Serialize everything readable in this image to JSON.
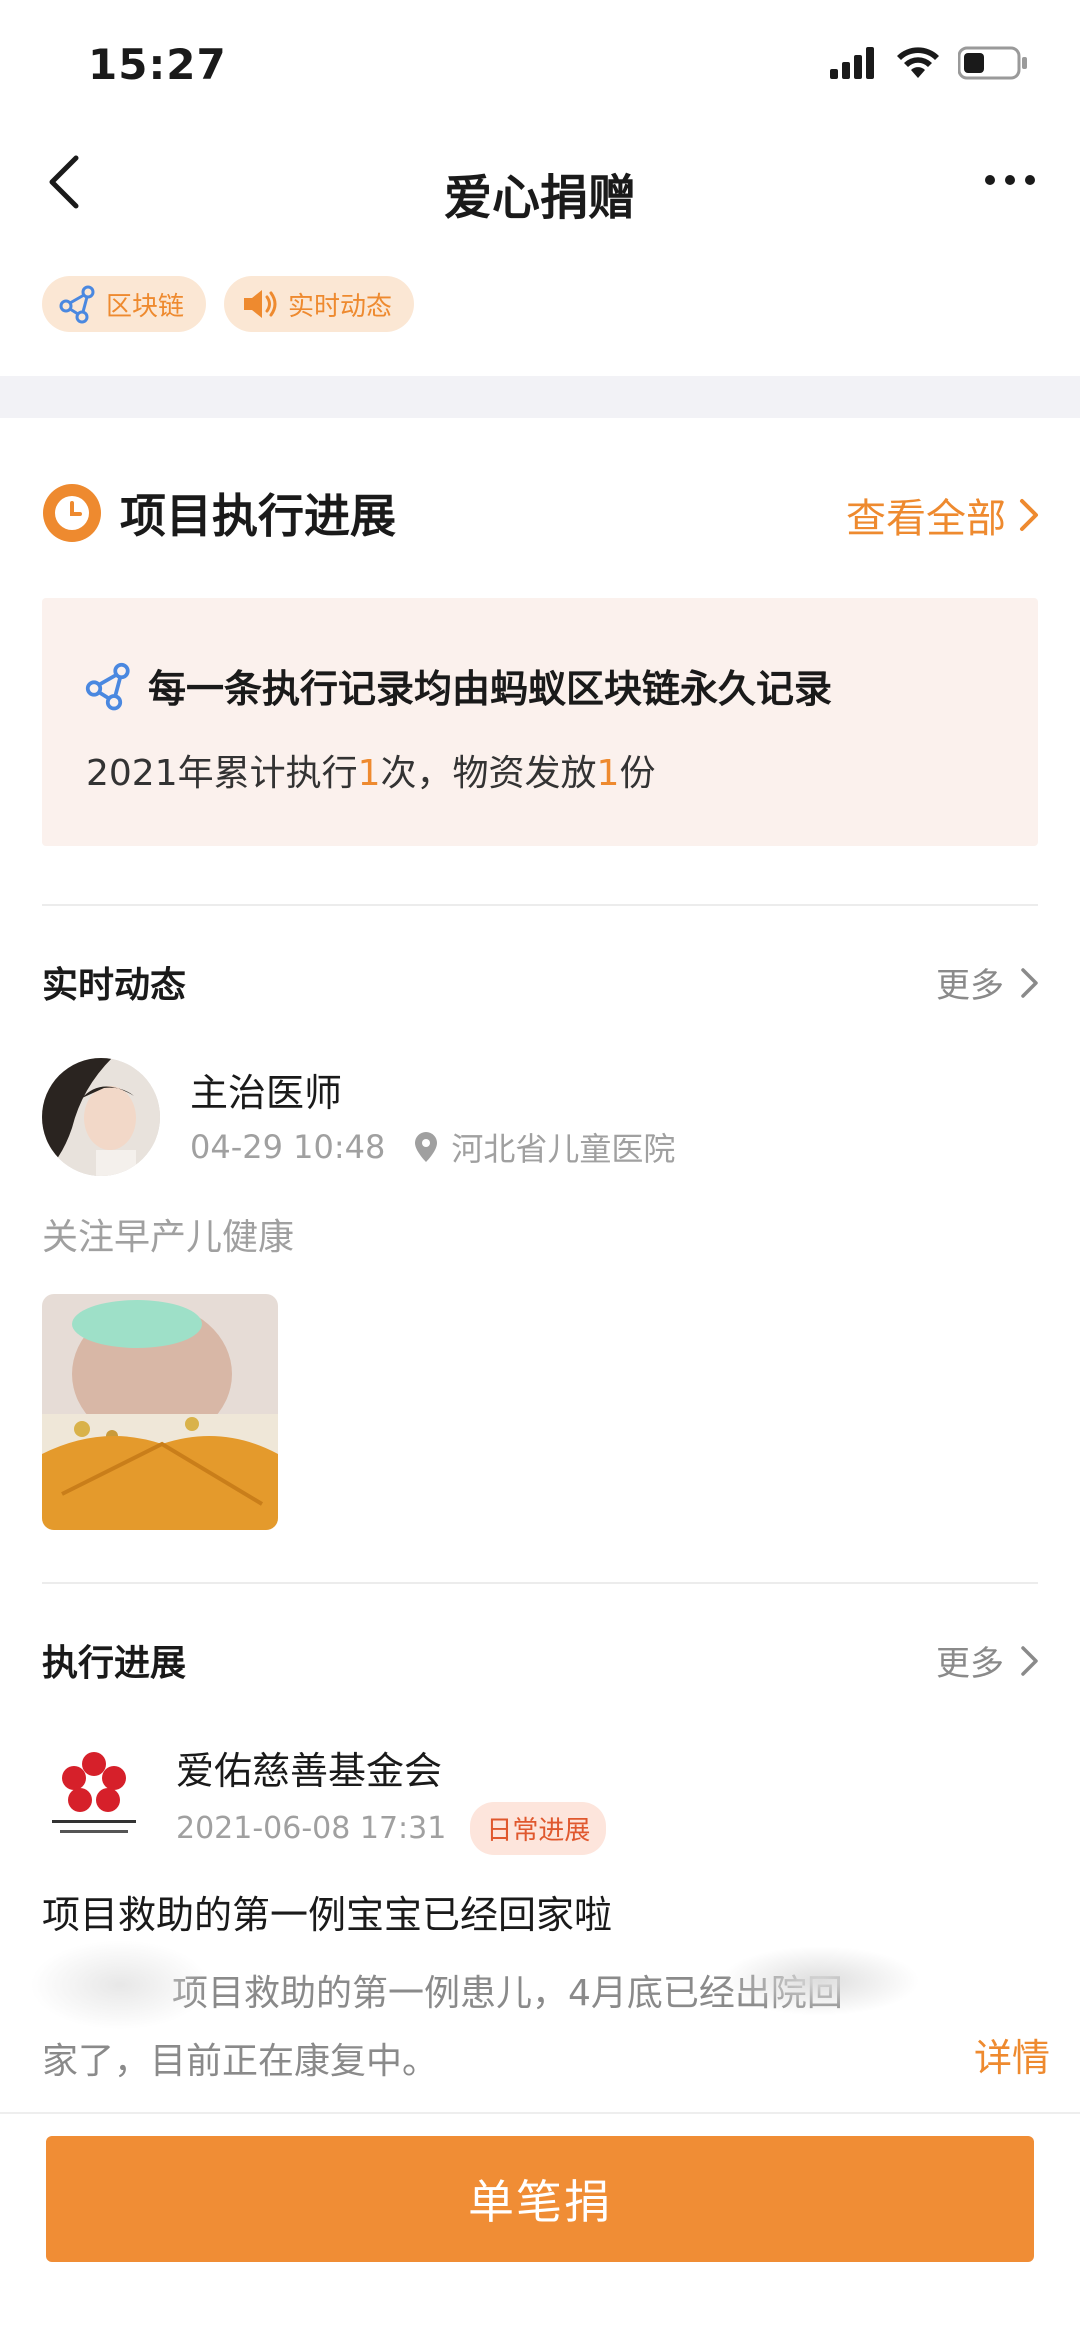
{
  "status_bar": {
    "time": "15:27"
  },
  "nav": {
    "title": "爱心捐赠"
  },
  "chips": [
    {
      "label": "区块链",
      "icon": "blockchain-icon"
    },
    {
      "label": "实时动态",
      "icon": "speaker-icon"
    }
  ],
  "execution": {
    "title": "项目执行进展",
    "view_all": "查看全部",
    "notice": "每一条执行记录均由蚂蚁区块链永久记录",
    "summary_prefix": "2021年累计执行",
    "exec_count": "1",
    "summary_mid": "次，物资发放",
    "supply_count": "1",
    "summary_suffix": "份"
  },
  "live_updates": {
    "title": "实时动态",
    "more": "更多",
    "post": {
      "author": "主治医师",
      "time": "04-29 10:48",
      "location": "河北省儿童医院",
      "text": "关注早产儿健康"
    }
  },
  "progress": {
    "title": "执行进展",
    "more": "更多",
    "org_name": "爱佑慈善基金会",
    "datetime": "2021-06-08 17:31",
    "tag": "日常进展",
    "headline": "项目救助的第一例宝宝已经回家啦",
    "body_line1": "项目救助的第一例患儿，4月底已经出院回",
    "body_line2": "家了，目前正在康复中。",
    "detail": "详情"
  },
  "action": {
    "donate_label": "单笔捐"
  },
  "colors": {
    "accent": "#ee8a2f",
    "button": "#f08d35",
    "notice_bg": "#fbf1ed",
    "tag_text": "#e0582e"
  }
}
